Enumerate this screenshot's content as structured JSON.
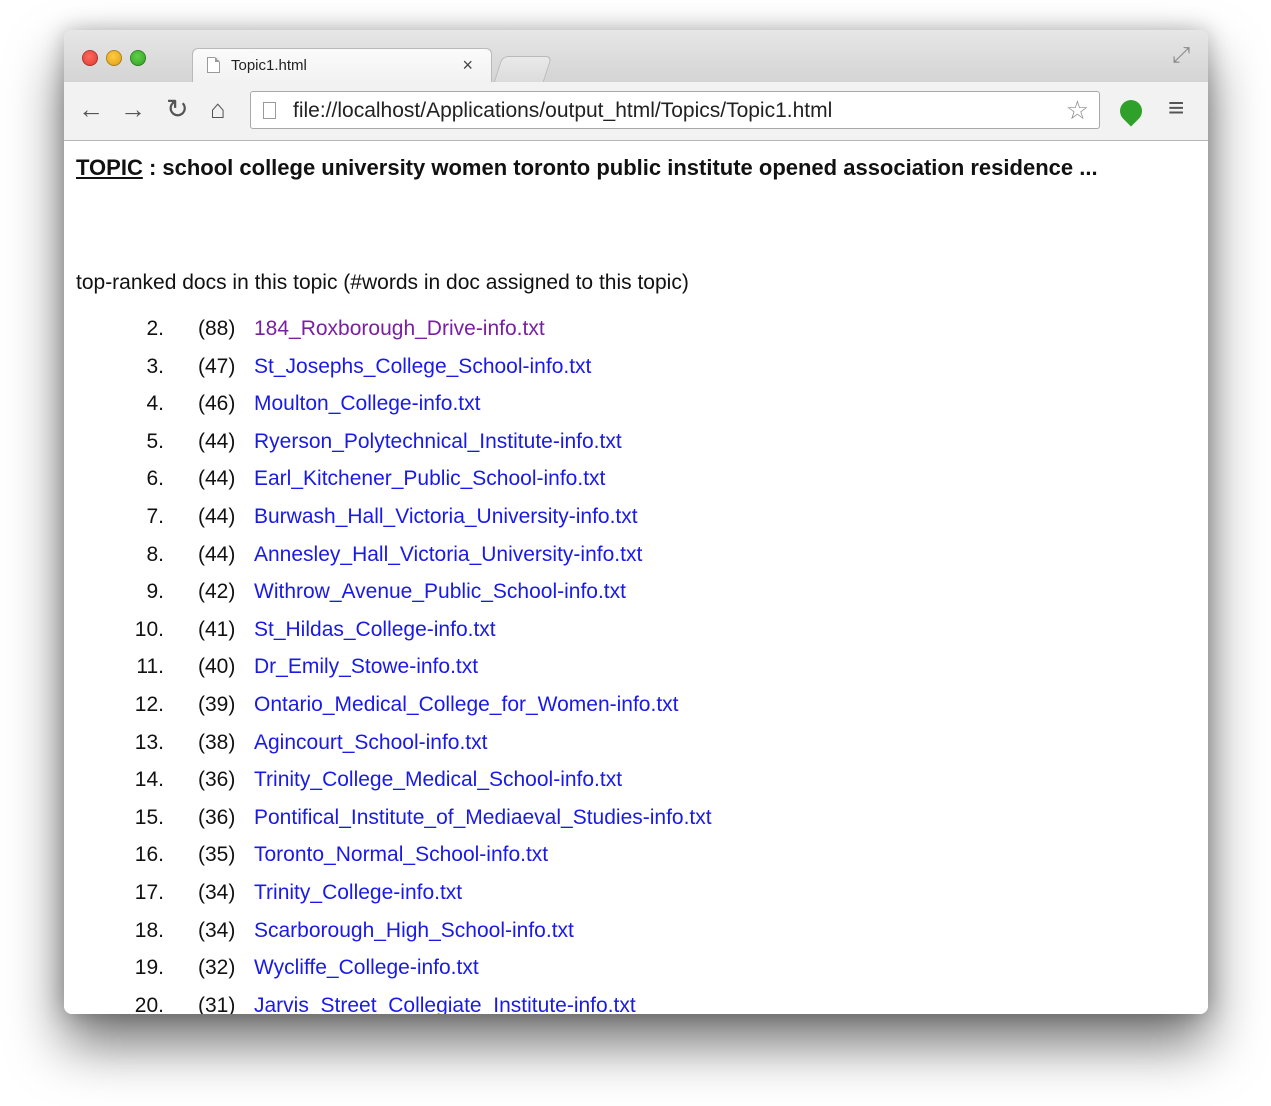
{
  "browser": {
    "tab_title": "Topic1.html",
    "tab_close": "×",
    "url": "file://localhost/Applications/output_html/Topics/Topic1.html",
    "icons": {
      "back": "back-arrow-icon",
      "forward": "forward-arrow-icon",
      "reload": "reload-icon",
      "home": "home-icon",
      "bookmark": "star-icon",
      "extension": "extension-icon",
      "menu": "menu-icon",
      "fullscreen": "fullscreen-icon"
    }
  },
  "page": {
    "topic_label": "TOPIC",
    "topic_words": " : school college university women toronto public institute opened association residence ...",
    "intro": "top-ranked docs in this topic (#words in doc assigned to this topic)",
    "docs": [
      {
        "rank": "2.",
        "count": "(88)",
        "name": "184_Roxborough_Drive-info.txt",
        "visited": true
      },
      {
        "rank": "3.",
        "count": "(47)",
        "name": "St_Josephs_College_School-info.txt"
      },
      {
        "rank": "4.",
        "count": "(46)",
        "name": "Moulton_College-info.txt"
      },
      {
        "rank": "5.",
        "count": "(44)",
        "name": "Ryerson_Polytechnical_Institute-info.txt"
      },
      {
        "rank": "6.",
        "count": "(44)",
        "name": "Earl_Kitchener_Public_School-info.txt"
      },
      {
        "rank": "7.",
        "count": "(44)",
        "name": "Burwash_Hall_Victoria_University-info.txt"
      },
      {
        "rank": "8.",
        "count": "(44)",
        "name": "Annesley_Hall_Victoria_University-info.txt"
      },
      {
        "rank": "9.",
        "count": "(42)",
        "name": "Withrow_Avenue_Public_School-info.txt"
      },
      {
        "rank": "10.",
        "count": "(41)",
        "name": "St_Hildas_College-info.txt"
      },
      {
        "rank": "11.",
        "count": "(40)",
        "name": "Dr_Emily_Stowe-info.txt"
      },
      {
        "rank": "12.",
        "count": "(39)",
        "name": "Ontario_Medical_College_for_Women-info.txt"
      },
      {
        "rank": "13.",
        "count": "(38)",
        "name": "Agincourt_School-info.txt"
      },
      {
        "rank": "14.",
        "count": "(36)",
        "name": "Trinity_College_Medical_School-info.txt"
      },
      {
        "rank": "15.",
        "count": "(36)",
        "name": "Pontifical_Institute_of_Mediaeval_Studies-info.txt"
      },
      {
        "rank": "16.",
        "count": "(35)",
        "name": "Toronto_Normal_School-info.txt"
      },
      {
        "rank": "17.",
        "count": "(34)",
        "name": "Trinity_College-info.txt"
      },
      {
        "rank": "18.",
        "count": "(34)",
        "name": "Scarborough_High_School-info.txt"
      },
      {
        "rank": "19.",
        "count": "(32)",
        "name": "Wycliffe_College-info.txt"
      },
      {
        "rank": "20.",
        "count": "(31)",
        "name": "Jarvis_Street_Collegiate_Institute-info.txt"
      }
    ]
  },
  "colors": {
    "link": "#1a1ae8",
    "visited_link": "#7b1fa2"
  }
}
